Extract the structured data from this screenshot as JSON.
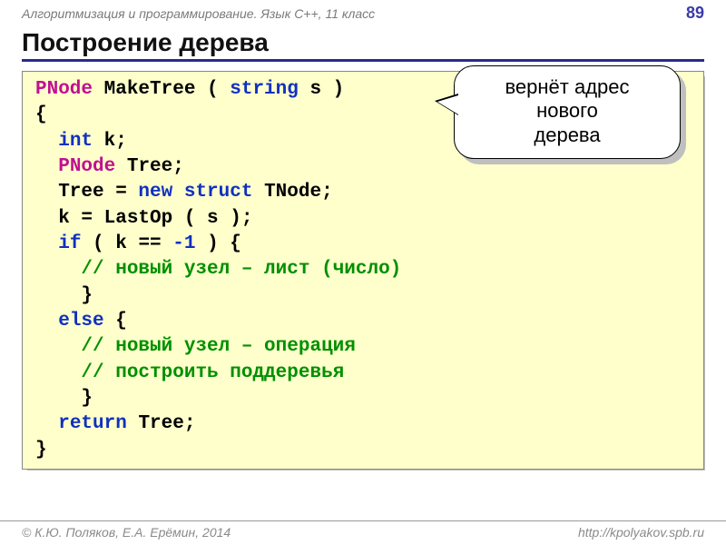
{
  "header": {
    "course": "Алгоритмизация и программирование. Язык C++, 11 класс",
    "page": "89"
  },
  "title": "Построение дерева",
  "code": {
    "l1a": "PNode",
    "l1b": " MakeTree ( ",
    "l1c": "string",
    "l1d": " s )",
    "l2": "{",
    "l3a": "  ",
    "l3b": "int",
    "l3c": " k;",
    "l4a": "  ",
    "l4b": "PNode",
    "l4c": " Tree;",
    "l5a": "  Tree = ",
    "l5b": "new",
    "l5c": " ",
    "l5d": "struct",
    "l5e": " TNode;",
    "l6": "  k = LastOp ( s );",
    "l7a": "  ",
    "l7b": "if",
    "l7c": " ( k == ",
    "l7d": "-1",
    "l7e": " ) {",
    "l8a": "    ",
    "l8b": "// новый узел – лист (число)",
    "l9": "    }",
    "l10a": "  ",
    "l10b": "else",
    "l10c": " {",
    "l11a": "    ",
    "l11b": "// новый узел – операция",
    "l12a": "    ",
    "l12b": "// построить поддеревья",
    "l13": "    }",
    "l14a": "  ",
    "l14b": "return",
    "l14c": " Tree;",
    "l15": "}"
  },
  "callout": {
    "line1": "вернёт адрес",
    "line2": "нового",
    "line3": "дерева"
  },
  "footer": {
    "left": "© К.Ю. Поляков, Е.А. Ерёмин, 2014",
    "right": "http://kpolyakov.spb.ru"
  }
}
